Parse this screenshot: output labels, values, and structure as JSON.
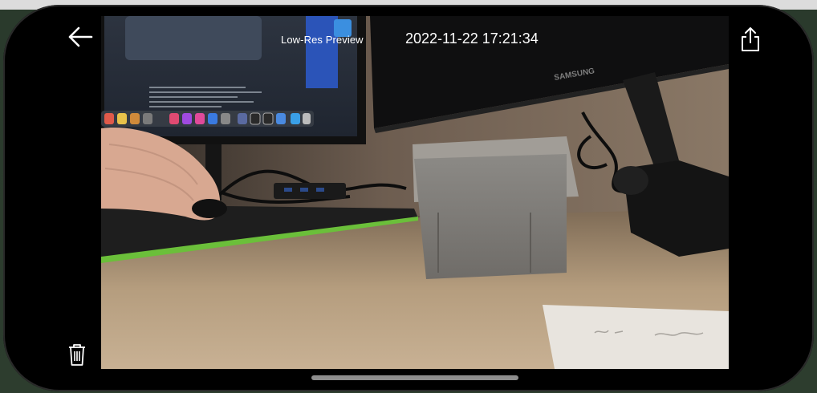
{
  "viewer": {
    "title": "Low-Res Preview",
    "timestamp": "2022-11-22 17:21:34"
  },
  "icons": {
    "back": "arrow-left-icon",
    "share": "share-icon",
    "trash": "trash-icon"
  },
  "photo": {
    "monitor_brand": "SAMSUNG"
  },
  "colors": {
    "overlay_text": "#ffffff",
    "frame": "#000000",
    "home_indicator": "#8d8d8d"
  }
}
